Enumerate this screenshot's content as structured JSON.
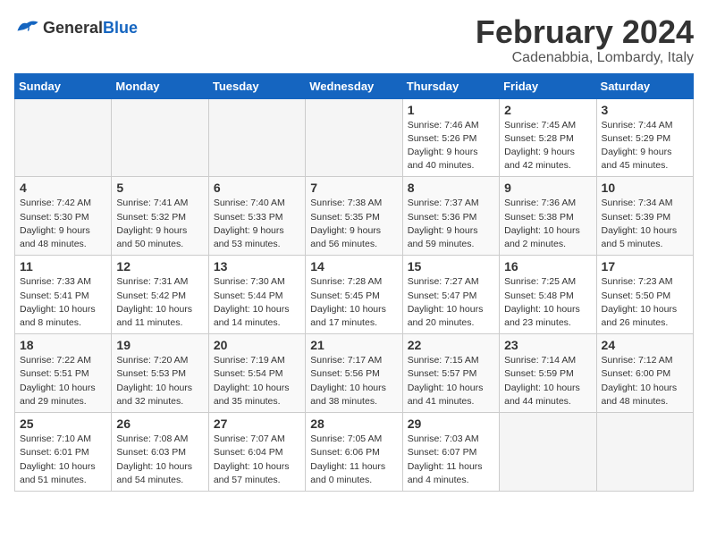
{
  "header": {
    "logo_general": "General",
    "logo_blue": "Blue",
    "title": "February 2024",
    "subtitle": "Cadenabbia, Lombardy, Italy"
  },
  "days_of_week": [
    "Sunday",
    "Monday",
    "Tuesday",
    "Wednesday",
    "Thursday",
    "Friday",
    "Saturday"
  ],
  "weeks": [
    [
      {
        "day": "",
        "empty": true
      },
      {
        "day": "",
        "empty": true
      },
      {
        "day": "",
        "empty": true
      },
      {
        "day": "",
        "empty": true
      },
      {
        "day": "1",
        "sunrise": "7:46 AM",
        "sunset": "5:26 PM",
        "daylight": "9 hours and 40 minutes."
      },
      {
        "day": "2",
        "sunrise": "7:45 AM",
        "sunset": "5:28 PM",
        "daylight": "9 hours and 42 minutes."
      },
      {
        "day": "3",
        "sunrise": "7:44 AM",
        "sunset": "5:29 PM",
        "daylight": "9 hours and 45 minutes."
      }
    ],
    [
      {
        "day": "4",
        "sunrise": "7:42 AM",
        "sunset": "5:30 PM",
        "daylight": "9 hours and 48 minutes."
      },
      {
        "day": "5",
        "sunrise": "7:41 AM",
        "sunset": "5:32 PM",
        "daylight": "9 hours and 50 minutes."
      },
      {
        "day": "6",
        "sunrise": "7:40 AM",
        "sunset": "5:33 PM",
        "daylight": "9 hours and 53 minutes."
      },
      {
        "day": "7",
        "sunrise": "7:38 AM",
        "sunset": "5:35 PM",
        "daylight": "9 hours and 56 minutes."
      },
      {
        "day": "8",
        "sunrise": "7:37 AM",
        "sunset": "5:36 PM",
        "daylight": "9 hours and 59 minutes."
      },
      {
        "day": "9",
        "sunrise": "7:36 AM",
        "sunset": "5:38 PM",
        "daylight": "10 hours and 2 minutes."
      },
      {
        "day": "10",
        "sunrise": "7:34 AM",
        "sunset": "5:39 PM",
        "daylight": "10 hours and 5 minutes."
      }
    ],
    [
      {
        "day": "11",
        "sunrise": "7:33 AM",
        "sunset": "5:41 PM",
        "daylight": "10 hours and 8 minutes."
      },
      {
        "day": "12",
        "sunrise": "7:31 AM",
        "sunset": "5:42 PM",
        "daylight": "10 hours and 11 minutes."
      },
      {
        "day": "13",
        "sunrise": "7:30 AM",
        "sunset": "5:44 PM",
        "daylight": "10 hours and 14 minutes."
      },
      {
        "day": "14",
        "sunrise": "7:28 AM",
        "sunset": "5:45 PM",
        "daylight": "10 hours and 17 minutes."
      },
      {
        "day": "15",
        "sunrise": "7:27 AM",
        "sunset": "5:47 PM",
        "daylight": "10 hours and 20 minutes."
      },
      {
        "day": "16",
        "sunrise": "7:25 AM",
        "sunset": "5:48 PM",
        "daylight": "10 hours and 23 minutes."
      },
      {
        "day": "17",
        "sunrise": "7:23 AM",
        "sunset": "5:50 PM",
        "daylight": "10 hours and 26 minutes."
      }
    ],
    [
      {
        "day": "18",
        "sunrise": "7:22 AM",
        "sunset": "5:51 PM",
        "daylight": "10 hours and 29 minutes."
      },
      {
        "day": "19",
        "sunrise": "7:20 AM",
        "sunset": "5:53 PM",
        "daylight": "10 hours and 32 minutes."
      },
      {
        "day": "20",
        "sunrise": "7:19 AM",
        "sunset": "5:54 PM",
        "daylight": "10 hours and 35 minutes."
      },
      {
        "day": "21",
        "sunrise": "7:17 AM",
        "sunset": "5:56 PM",
        "daylight": "10 hours and 38 minutes."
      },
      {
        "day": "22",
        "sunrise": "7:15 AM",
        "sunset": "5:57 PM",
        "daylight": "10 hours and 41 minutes."
      },
      {
        "day": "23",
        "sunrise": "7:14 AM",
        "sunset": "5:59 PM",
        "daylight": "10 hours and 44 minutes."
      },
      {
        "day": "24",
        "sunrise": "7:12 AM",
        "sunset": "6:00 PM",
        "daylight": "10 hours and 48 minutes."
      }
    ],
    [
      {
        "day": "25",
        "sunrise": "7:10 AM",
        "sunset": "6:01 PM",
        "daylight": "10 hours and 51 minutes."
      },
      {
        "day": "26",
        "sunrise": "7:08 AM",
        "sunset": "6:03 PM",
        "daylight": "10 hours and 54 minutes."
      },
      {
        "day": "27",
        "sunrise": "7:07 AM",
        "sunset": "6:04 PM",
        "daylight": "10 hours and 57 minutes."
      },
      {
        "day": "28",
        "sunrise": "7:05 AM",
        "sunset": "6:06 PM",
        "daylight": "11 hours and 0 minutes."
      },
      {
        "day": "29",
        "sunrise": "7:03 AM",
        "sunset": "6:07 PM",
        "daylight": "11 hours and 4 minutes."
      },
      {
        "day": "",
        "empty": true
      },
      {
        "day": "",
        "empty": true
      }
    ]
  ],
  "labels": {
    "sunrise": "Sunrise:",
    "sunset": "Sunset:",
    "daylight": "Daylight:"
  }
}
